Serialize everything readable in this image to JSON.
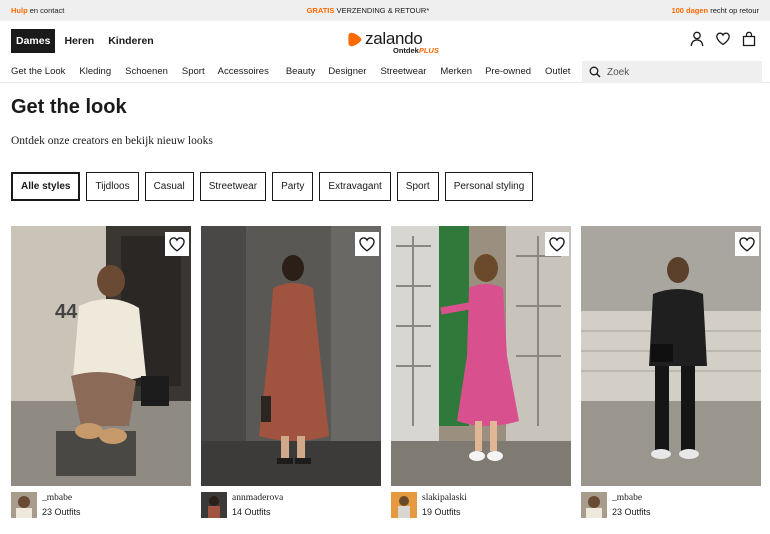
{
  "topbar": {
    "help_strong": "Hulp",
    "help_rest": " en contact",
    "center_strong": "GRATIS",
    "center_rest": " VERZENDING & RETOUR*",
    "right_strong": "100 dagen",
    "right_rest": " recht op retour"
  },
  "header": {
    "genders": [
      "Dames",
      "Heren",
      "Kinderen"
    ],
    "logo_word": "zalando",
    "logo_sub": "Ontdek",
    "logo_plus": "PLUS",
    "icons": [
      "user-icon",
      "heart-icon",
      "bag-icon"
    ]
  },
  "catnav": {
    "items": [
      "Get the Look",
      "Kleding",
      "Schoenen",
      "Sport",
      "Accessoires",
      "Beauty",
      "Designer",
      "Streetwear",
      "Merken",
      "Pre-owned",
      "Outlet"
    ],
    "search_placeholder": "Zoek"
  },
  "main": {
    "title": "Get the look",
    "subtitle": "Ontdek onze creators en bekijk nieuw looks",
    "filters": [
      "Alle styles",
      "Tijdloos",
      "Casual",
      "Streetwear",
      "Party",
      "Extravagant",
      "Sport",
      "Personal styling"
    ],
    "active_filter": "Alle styles"
  },
  "cards": [
    {
      "name": "_mbabe",
      "count": "23 Outfits"
    },
    {
      "name": "annmaderova",
      "count": "14 Outfits"
    },
    {
      "name": "slakipalaski",
      "count": "19 Outfits"
    },
    {
      "name": "_mbabe",
      "count": "23 Outfits"
    }
  ],
  "colors": {
    "accent": "#ff6900",
    "text": "#1a1a1a",
    "bar": "#efeff0"
  }
}
